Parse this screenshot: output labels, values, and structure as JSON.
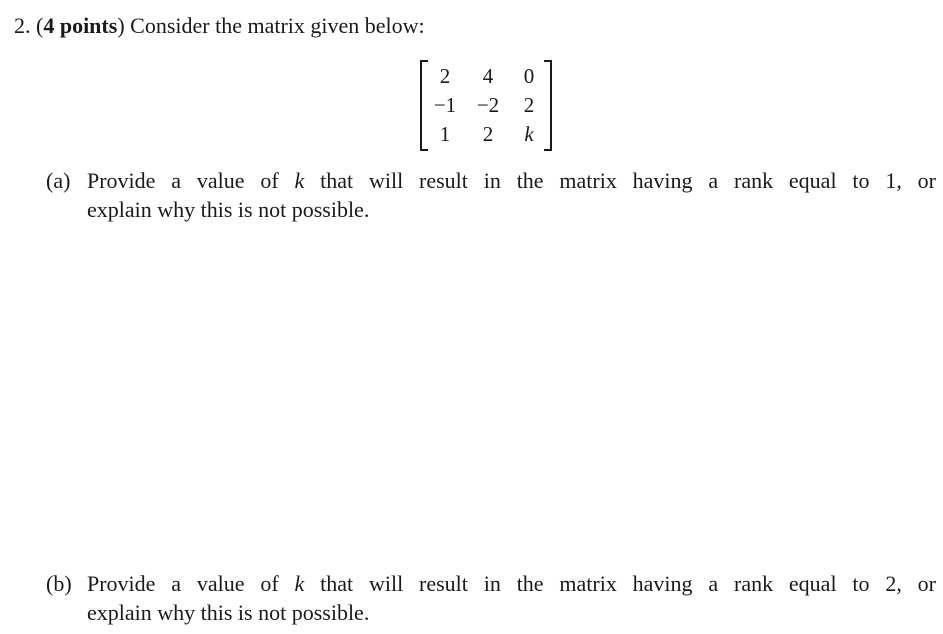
{
  "problem": {
    "number": "2.",
    "points_open": "(",
    "points_label": "4 points",
    "points_close": ")",
    "prompt": "Consider the matrix given below:"
  },
  "matrix": {
    "rows": [
      [
        "2",
        "4",
        "0"
      ],
      [
        "−1",
        "−2",
        "2"
      ],
      [
        "1",
        "2",
        "k"
      ]
    ]
  },
  "subquestions": [
    {
      "label": "(a)",
      "line1_before_var": "Provide a value of",
      "variable": "k",
      "line1_after_var": "that will result in the matrix having a rank equal to 1, or",
      "line2": "explain why this is not possible."
    },
    {
      "label": "(b)",
      "line1_before_var": "Provide a value of",
      "variable": "k",
      "line1_after_var": "that will result in the matrix having a rank equal to 2, or",
      "line2": "explain why this is not possible."
    }
  ]
}
